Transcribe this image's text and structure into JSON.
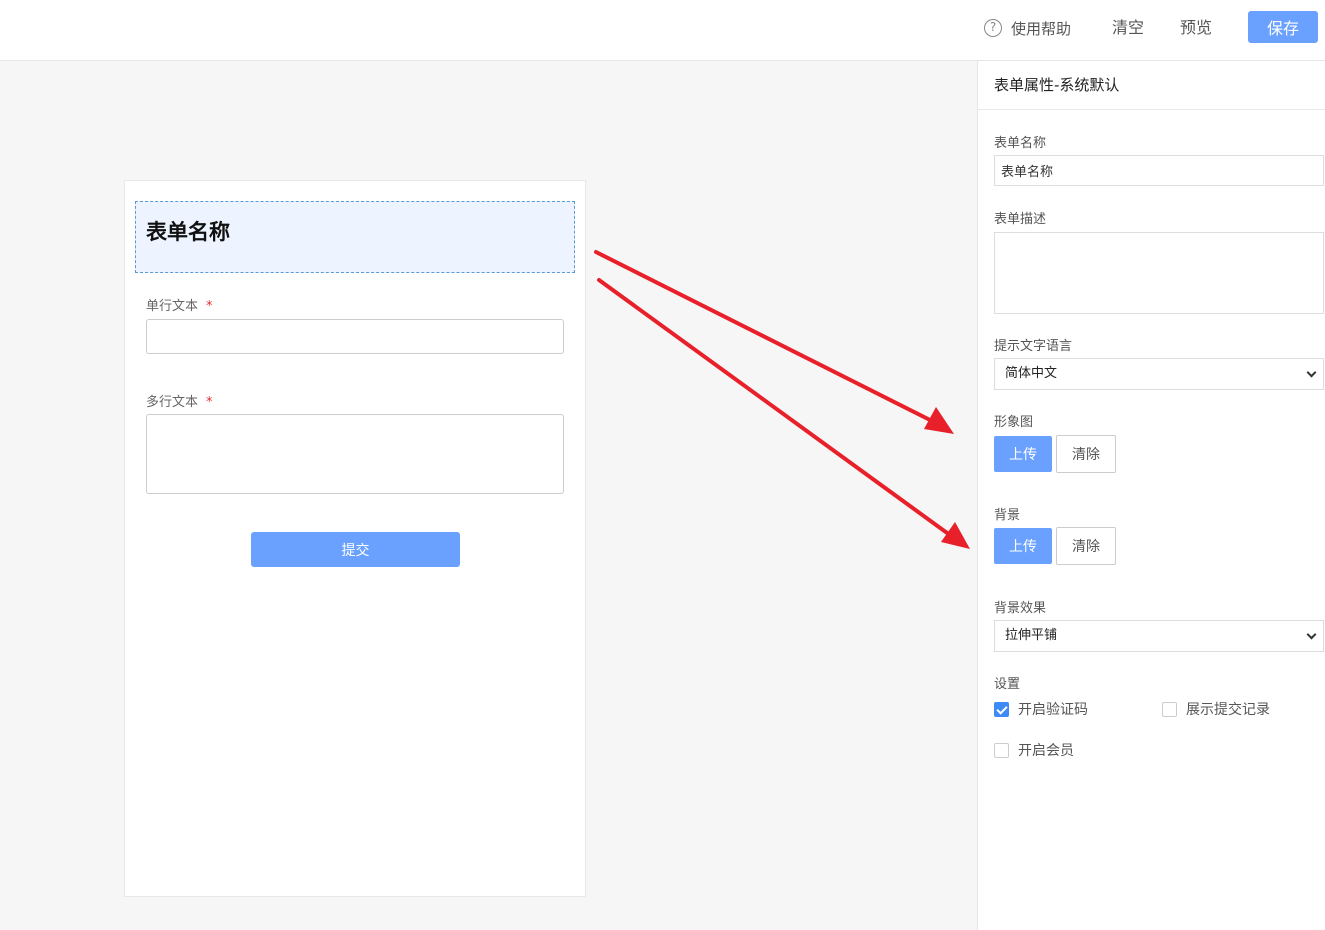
{
  "toolbar": {
    "help_label": "使用帮助",
    "help_icon": "?",
    "clear_label": "清空",
    "preview_label": "预览",
    "save_label": "保存"
  },
  "form": {
    "title": "表单名称",
    "fields": [
      {
        "label": "单行文本",
        "required_mark": "*",
        "type": "text"
      },
      {
        "label": "多行文本",
        "required_mark": "*",
        "type": "textarea"
      }
    ],
    "submit_label": "提交"
  },
  "panel": {
    "title": "表单属性-系统默认",
    "form_name_label": "表单名称",
    "form_name_value": "表单名称",
    "form_desc_label": "表单描述",
    "form_desc_value": "",
    "lang_label": "提示文字语言",
    "lang_value": "简体中文",
    "avatar_label": "形象图",
    "background_label": "背景",
    "upload_label": "上传",
    "clear_label": "清除",
    "bg_effect_label": "背景效果",
    "bg_effect_value": "拉伸平铺",
    "settings_label": "设置",
    "settings": [
      {
        "label": "开启验证码",
        "checked": true
      },
      {
        "label": "展示提交记录",
        "checked": false
      },
      {
        "label": "开启会员",
        "checked": false
      }
    ]
  },
  "colors": {
    "accent": "#6aa1ff",
    "arrow": "#e8202a",
    "required": "#e03030"
  }
}
